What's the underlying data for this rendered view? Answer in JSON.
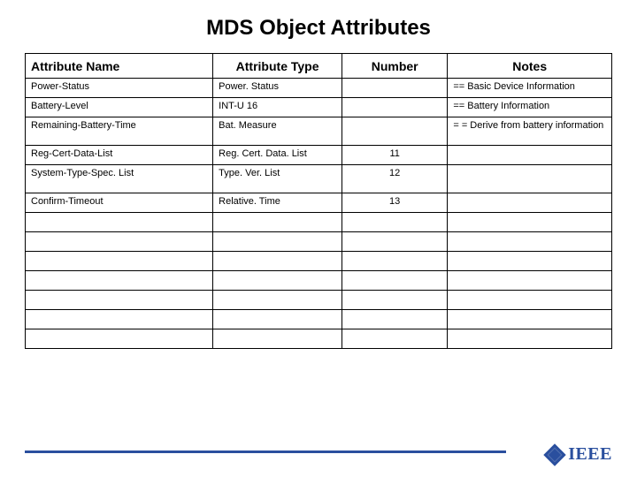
{
  "title": "MDS Object Attributes",
  "headers": {
    "name": "Attribute Name",
    "type": "Attribute Type",
    "number": "Number",
    "notes": "Notes"
  },
  "rows": [
    {
      "name": "Power-Status",
      "type": "Power. Status",
      "number": "",
      "notes": "== Basic Device Information"
    },
    {
      "name": "Battery-Level",
      "type": "INT-U 16",
      "number": "",
      "notes": "== Battery Information"
    },
    {
      "name": "Remaining-Battery-Time",
      "type": "Bat. Measure",
      "number": "",
      "notes": "= = Derive from battery information",
      "tall": true
    },
    {
      "name": "Reg-Cert-Data-List",
      "type": "Reg. Cert. Data. List",
      "number": "11",
      "notes": ""
    },
    {
      "name": "System-Type-Spec. List",
      "type": "Type. Ver. List",
      "number": "12",
      "notes": "",
      "tall": true
    },
    {
      "name": "Confirm-Timeout",
      "type": "Relative. Time",
      "number": "13",
      "notes": ""
    },
    {
      "name": "",
      "type": "",
      "number": "",
      "notes": ""
    },
    {
      "name": "",
      "type": "",
      "number": "",
      "notes": ""
    },
    {
      "name": "",
      "type": "",
      "number": "",
      "notes": ""
    },
    {
      "name": "",
      "type": "",
      "number": "",
      "notes": ""
    },
    {
      "name": "",
      "type": "",
      "number": "",
      "notes": ""
    },
    {
      "name": "",
      "type": "",
      "number": "",
      "notes": ""
    },
    {
      "name": "",
      "type": "",
      "number": "",
      "notes": ""
    }
  ],
  "logo_text": "IEEE"
}
